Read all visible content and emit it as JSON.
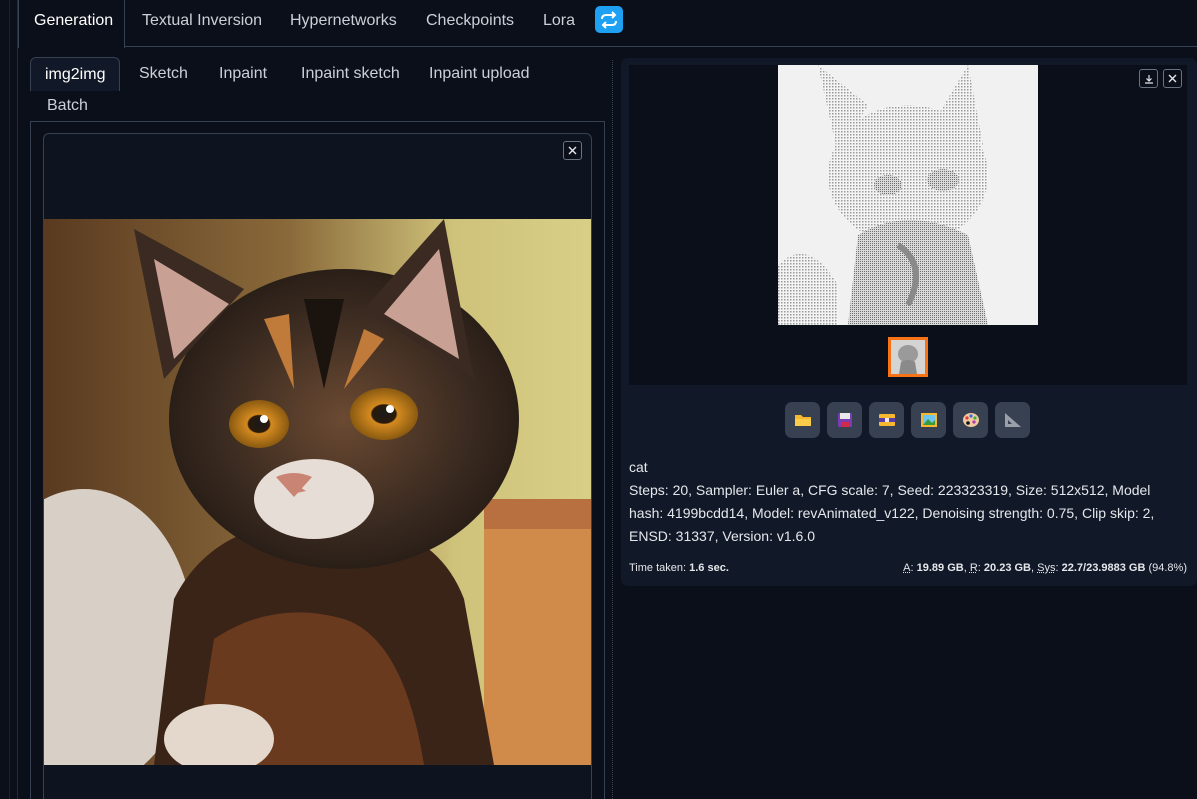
{
  "top_tabs": [
    "Generation",
    "Textual Inversion",
    "Hypernetworks",
    "Checkpoints",
    "Lora"
  ],
  "sub_tabs": [
    "img2img",
    "Sketch",
    "Inpaint",
    "Inpaint sketch",
    "Inpaint upload",
    "Batch"
  ],
  "output": {
    "prompt": "cat",
    "params": "Steps: 20, Sampler: Euler a, CFG scale: 7, Seed: 223323319, Size: 512x512, Model hash: 4199bcdd14, Model: revAnimated_v122, Denoising strength: 0.75, Clip skip: 2, ENSD: 31337, Version: v1.6.0",
    "time_label": "Time taken:",
    "time_value": "1.6 sec.",
    "mem_a_label": "A",
    "mem_a_value": "19.89 GB",
    "mem_r_label": "R",
    "mem_r_value": "20.23 GB",
    "mem_sys_label": "Sys",
    "mem_sys_value": "22.7/23.9883 GB",
    "mem_pct": "(94.8%)"
  },
  "toolbar_icons": [
    "folder-icon",
    "save-icon",
    "zip-icon",
    "image-icon",
    "palette-icon",
    "ruler-icon"
  ],
  "colors": {
    "accent": "#f97316",
    "refresh": "#1ea1f2",
    "bg": "#0b0f19",
    "panel": "#111827"
  }
}
